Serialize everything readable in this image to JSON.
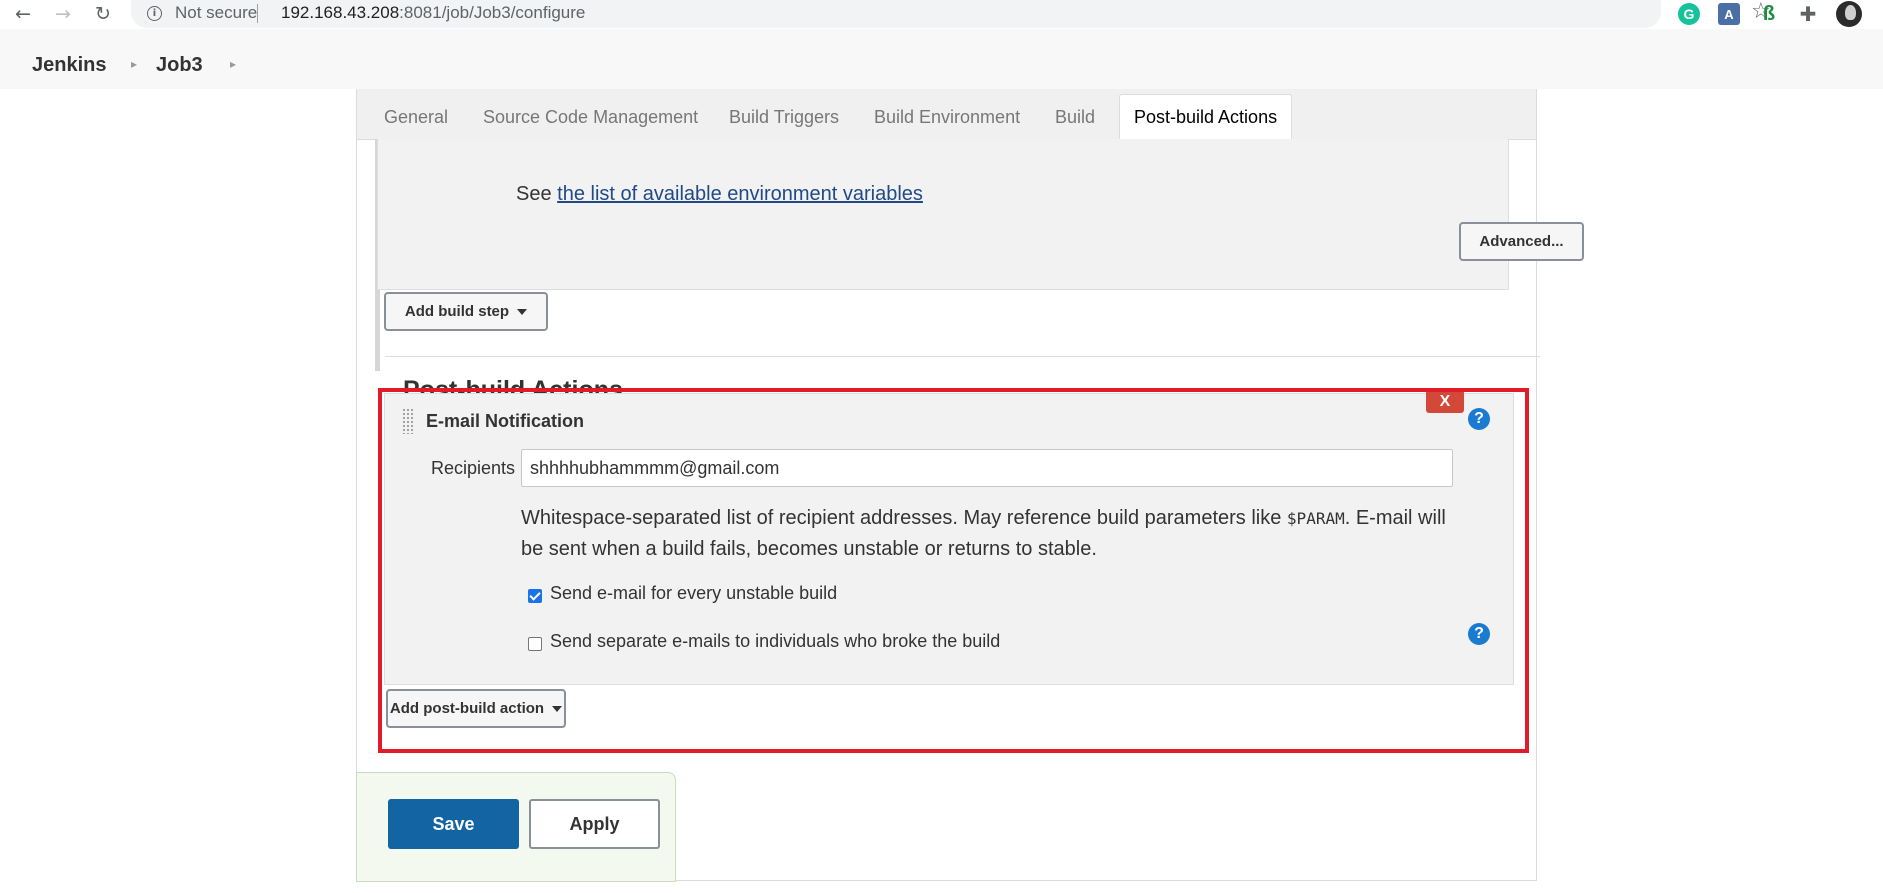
{
  "browser": {
    "security_label": "Not secure",
    "url_host": "192.168.43.208",
    "url_rest": ":8081/job/Job3/configure"
  },
  "breadcrumb": [
    "Jenkins",
    "Job3"
  ],
  "tabs": [
    {
      "label": "General"
    },
    {
      "label": "Source Code Management"
    },
    {
      "label": "Build Triggers"
    },
    {
      "label": "Build Environment"
    },
    {
      "label": "Build"
    },
    {
      "label": "Post-build Actions"
    }
  ],
  "build": {
    "see_prefix": "See",
    "env_link": "the list of available environment variables",
    "advanced_label": "Advanced...",
    "add_step_label": "Add build step"
  },
  "post_build": {
    "title": "Post-build Actions",
    "email": {
      "title": "E-mail Notification",
      "delete_label": "X",
      "recipients_label": "Recipients",
      "recipients_value": "shhhhubhammmm@gmail.com",
      "desc_part1": "Whitespace-separated list of recipient addresses. May reference build parameters like ",
      "desc_code": "$PARAM",
      "desc_part2": ". E-mail will be sent when a build fails, becomes unstable or returns to stable.",
      "checkbox_unstable": {
        "label": "Send e-mail for every unstable build",
        "checked": true
      },
      "checkbox_individuals": {
        "label": "Send separate e-mails to individuals who broke the build",
        "checked": false
      }
    },
    "add_action_label": "Add post-build action"
  },
  "actions": {
    "save_label": "Save",
    "apply_label": "Apply"
  },
  "colors": {
    "highlight": "#e21b2b",
    "save": "#1264a3",
    "help": "#1a7bd1",
    "delete": "#d24939"
  }
}
